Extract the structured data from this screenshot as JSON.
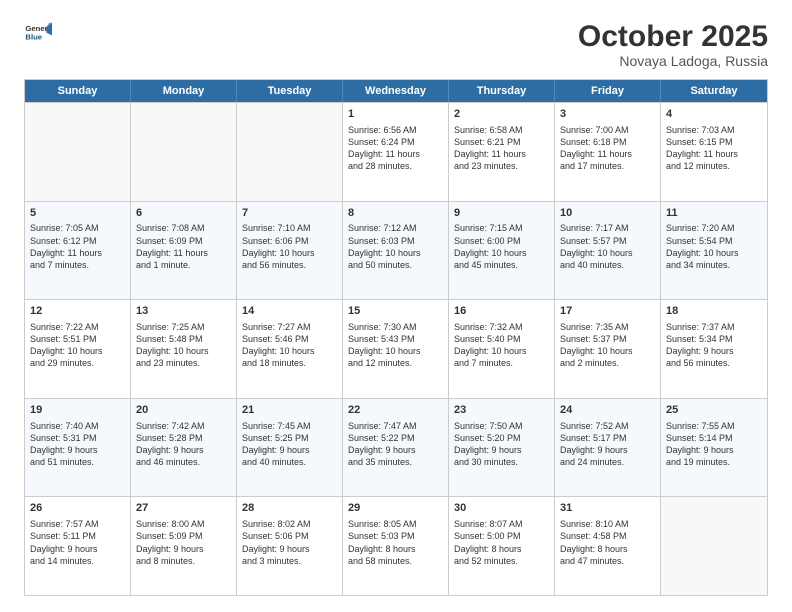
{
  "header": {
    "logo_general": "General",
    "logo_blue": "Blue",
    "month_title": "October 2025",
    "location": "Novaya Ladoga, Russia"
  },
  "calendar": {
    "weekdays": [
      "Sunday",
      "Monday",
      "Tuesday",
      "Wednesday",
      "Thursday",
      "Friday",
      "Saturday"
    ],
    "rows": [
      [
        {
          "day": "",
          "text": ""
        },
        {
          "day": "",
          "text": ""
        },
        {
          "day": "",
          "text": ""
        },
        {
          "day": "1",
          "text": "Sunrise: 6:56 AM\nSunset: 6:24 PM\nDaylight: 11 hours\nand 28 minutes."
        },
        {
          "day": "2",
          "text": "Sunrise: 6:58 AM\nSunset: 6:21 PM\nDaylight: 11 hours\nand 23 minutes."
        },
        {
          "day": "3",
          "text": "Sunrise: 7:00 AM\nSunset: 6:18 PM\nDaylight: 11 hours\nand 17 minutes."
        },
        {
          "day": "4",
          "text": "Sunrise: 7:03 AM\nSunset: 6:15 PM\nDaylight: 11 hours\nand 12 minutes."
        }
      ],
      [
        {
          "day": "5",
          "text": "Sunrise: 7:05 AM\nSunset: 6:12 PM\nDaylight: 11 hours\nand 7 minutes."
        },
        {
          "day": "6",
          "text": "Sunrise: 7:08 AM\nSunset: 6:09 PM\nDaylight: 11 hours\nand 1 minute."
        },
        {
          "day": "7",
          "text": "Sunrise: 7:10 AM\nSunset: 6:06 PM\nDaylight: 10 hours\nand 56 minutes."
        },
        {
          "day": "8",
          "text": "Sunrise: 7:12 AM\nSunset: 6:03 PM\nDaylight: 10 hours\nand 50 minutes."
        },
        {
          "day": "9",
          "text": "Sunrise: 7:15 AM\nSunset: 6:00 PM\nDaylight: 10 hours\nand 45 minutes."
        },
        {
          "day": "10",
          "text": "Sunrise: 7:17 AM\nSunset: 5:57 PM\nDaylight: 10 hours\nand 40 minutes."
        },
        {
          "day": "11",
          "text": "Sunrise: 7:20 AM\nSunset: 5:54 PM\nDaylight: 10 hours\nand 34 minutes."
        }
      ],
      [
        {
          "day": "12",
          "text": "Sunrise: 7:22 AM\nSunset: 5:51 PM\nDaylight: 10 hours\nand 29 minutes."
        },
        {
          "day": "13",
          "text": "Sunrise: 7:25 AM\nSunset: 5:48 PM\nDaylight: 10 hours\nand 23 minutes."
        },
        {
          "day": "14",
          "text": "Sunrise: 7:27 AM\nSunset: 5:46 PM\nDaylight: 10 hours\nand 18 minutes."
        },
        {
          "day": "15",
          "text": "Sunrise: 7:30 AM\nSunset: 5:43 PM\nDaylight: 10 hours\nand 12 minutes."
        },
        {
          "day": "16",
          "text": "Sunrise: 7:32 AM\nSunset: 5:40 PM\nDaylight: 10 hours\nand 7 minutes."
        },
        {
          "day": "17",
          "text": "Sunrise: 7:35 AM\nSunset: 5:37 PM\nDaylight: 10 hours\nand 2 minutes."
        },
        {
          "day": "18",
          "text": "Sunrise: 7:37 AM\nSunset: 5:34 PM\nDaylight: 9 hours\nand 56 minutes."
        }
      ],
      [
        {
          "day": "19",
          "text": "Sunrise: 7:40 AM\nSunset: 5:31 PM\nDaylight: 9 hours\nand 51 minutes."
        },
        {
          "day": "20",
          "text": "Sunrise: 7:42 AM\nSunset: 5:28 PM\nDaylight: 9 hours\nand 46 minutes."
        },
        {
          "day": "21",
          "text": "Sunrise: 7:45 AM\nSunset: 5:25 PM\nDaylight: 9 hours\nand 40 minutes."
        },
        {
          "day": "22",
          "text": "Sunrise: 7:47 AM\nSunset: 5:22 PM\nDaylight: 9 hours\nand 35 minutes."
        },
        {
          "day": "23",
          "text": "Sunrise: 7:50 AM\nSunset: 5:20 PM\nDaylight: 9 hours\nand 30 minutes."
        },
        {
          "day": "24",
          "text": "Sunrise: 7:52 AM\nSunset: 5:17 PM\nDaylight: 9 hours\nand 24 minutes."
        },
        {
          "day": "25",
          "text": "Sunrise: 7:55 AM\nSunset: 5:14 PM\nDaylight: 9 hours\nand 19 minutes."
        }
      ],
      [
        {
          "day": "26",
          "text": "Sunrise: 7:57 AM\nSunset: 5:11 PM\nDaylight: 9 hours\nand 14 minutes."
        },
        {
          "day": "27",
          "text": "Sunrise: 8:00 AM\nSunset: 5:09 PM\nDaylight: 9 hours\nand 8 minutes."
        },
        {
          "day": "28",
          "text": "Sunrise: 8:02 AM\nSunset: 5:06 PM\nDaylight: 9 hours\nand 3 minutes."
        },
        {
          "day": "29",
          "text": "Sunrise: 8:05 AM\nSunset: 5:03 PM\nDaylight: 8 hours\nand 58 minutes."
        },
        {
          "day": "30",
          "text": "Sunrise: 8:07 AM\nSunset: 5:00 PM\nDaylight: 8 hours\nand 52 minutes."
        },
        {
          "day": "31",
          "text": "Sunrise: 8:10 AM\nSunset: 4:58 PM\nDaylight: 8 hours\nand 47 minutes."
        },
        {
          "day": "",
          "text": ""
        }
      ]
    ]
  }
}
